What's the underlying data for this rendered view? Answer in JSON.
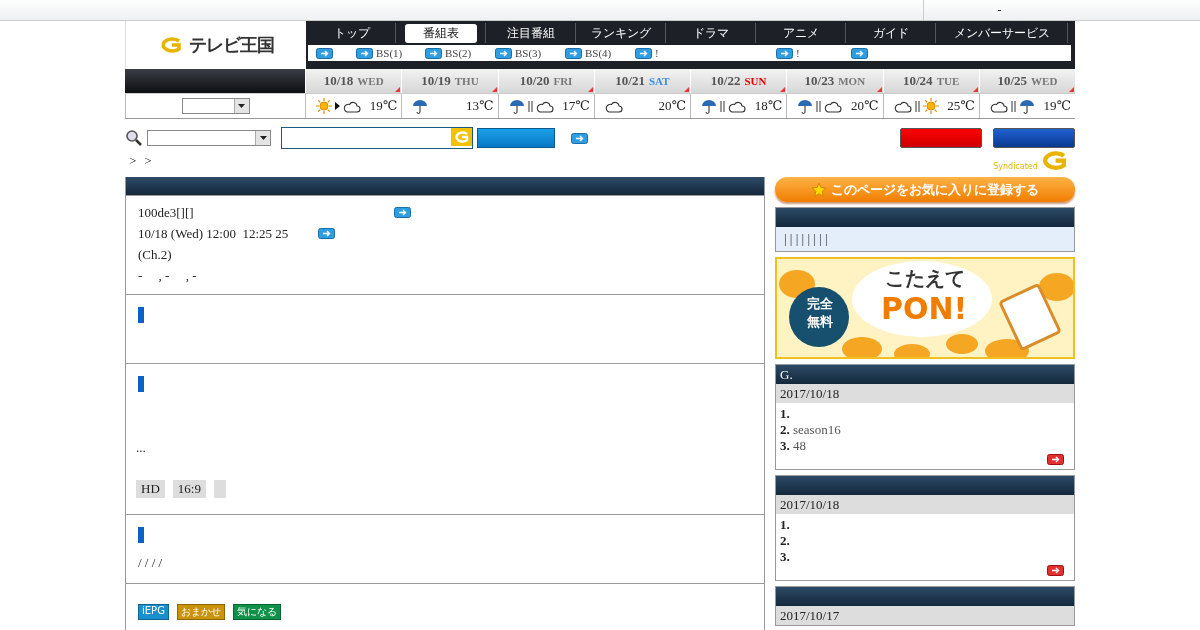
{
  "top_bar": {
    "text": "-"
  },
  "logo": {
    "text": "テレビ王国"
  },
  "nav": {
    "tabs": [
      {
        "label": "トップ",
        "selected": false
      },
      {
        "label": "番組表",
        "selected": true
      },
      {
        "label": "注目番組",
        "selected": false
      },
      {
        "label": "ランキング",
        "selected": false
      },
      {
        "label": "ドラマ",
        "selected": false
      },
      {
        "label": "アニメ",
        "selected": false
      },
      {
        "label": "ガイド",
        "selected": false
      },
      {
        "label": "メンバーサービス",
        "selected": false
      }
    ],
    "links": [
      {
        "kind": "icon_only"
      },
      {
        "kind": "labeled",
        "label": "BS(1)"
      },
      {
        "kind": "labeled",
        "label": "BS(2)"
      },
      {
        "kind": "labeled",
        "label": "BS(3)"
      },
      {
        "kind": "labeled",
        "label": "BS(4)"
      },
      {
        "kind": "labeled",
        "label": "!"
      },
      {
        "kind": "labeled",
        "label": "!"
      },
      {
        "kind": "icon_only"
      }
    ]
  },
  "days": [
    {
      "date": "10/18",
      "weekday": "WED",
      "kind": "weekday",
      "weather": [
        {
          "kind": "sun"
        },
        {
          "kind": "then"
        },
        {
          "kind": "cloud"
        }
      ],
      "temp": "19℃"
    },
    {
      "date": "10/19",
      "weekday": "THU",
      "kind": "weekday",
      "weather": [
        {
          "kind": "rain"
        }
      ],
      "temp": "13℃"
    },
    {
      "date": "10/20",
      "weekday": "FRI",
      "kind": "weekday",
      "weather": [
        {
          "kind": "rain"
        },
        {
          "kind": "or"
        },
        {
          "kind": "cloud"
        }
      ],
      "temp": "17℃"
    },
    {
      "date": "10/21",
      "weekday": "SAT",
      "kind": "saturday",
      "weather": [
        {
          "kind": "cloud"
        }
      ],
      "temp": "20℃"
    },
    {
      "date": "10/22",
      "weekday": "SUN",
      "kind": "sunday",
      "weather": [
        {
          "kind": "rain"
        },
        {
          "kind": "or"
        },
        {
          "kind": "cloud"
        }
      ],
      "temp": "18℃"
    },
    {
      "date": "10/23",
      "weekday": "MON",
      "kind": "weekday",
      "weather": [
        {
          "kind": "rain"
        },
        {
          "kind": "or"
        },
        {
          "kind": "cloud"
        }
      ],
      "temp": "20℃"
    },
    {
      "date": "10/24",
      "weekday": "TUE",
      "kind": "weekday",
      "weather": [
        {
          "kind": "cloud"
        },
        {
          "kind": "or"
        },
        {
          "kind": "sun"
        }
      ],
      "temp": "25℃"
    },
    {
      "date": "10/25",
      "weekday": "WED",
      "kind": "weekday",
      "weather": [
        {
          "kind": "cloud"
        },
        {
          "kind": "or"
        },
        {
          "kind": "rain"
        }
      ],
      "temp": "19℃"
    }
  ],
  "breadcrumb": [
    ">",
    ">"
  ],
  "syndicated": "Syndicated",
  "program": {
    "title": "100de3[][]",
    "time": "10/18 (Wed) 12:00  12:25 25",
    "channel": "(Ch.2)",
    "cast": "-     , -     , -"
  },
  "details": {
    "ellipsis": "...",
    "badges": [
      {
        "kind": "text",
        "label": "HD"
      },
      {
        "kind": "text",
        "label": "16:9"
      },
      {
        "kind": "blank"
      }
    ],
    "credits": "/ / / /"
  },
  "actions": [
    {
      "label": "iEPG",
      "color": "#1a8fd0"
    },
    {
      "label": "おまかせ",
      "color": "#c9940c"
    },
    {
      "label": "気になる",
      "color": "#10914a"
    }
  ],
  "sidebar": {
    "favorite": "このページをお気に入りに登録する",
    "genre_links": "| | | | | | | |",
    "banner": {
      "headline": "こたえて",
      "logo": "PON!",
      "badge_lines": [
        "完全",
        "無料"
      ]
    },
    "rankings": [
      {
        "title": "G.",
        "date": "2017/10/18",
        "items": [
          {
            "rank": "1."
          },
          {
            "rank": "2.",
            "text": "season16"
          },
          {
            "rank": "3.",
            "text": "48"
          }
        ]
      },
      {
        "date": "2017/10/18",
        "items": [
          {
            "rank": "1."
          },
          {
            "rank": "2."
          },
          {
            "rank": "3."
          }
        ]
      },
      {
        "date": "2017/10/17"
      }
    ]
  }
}
